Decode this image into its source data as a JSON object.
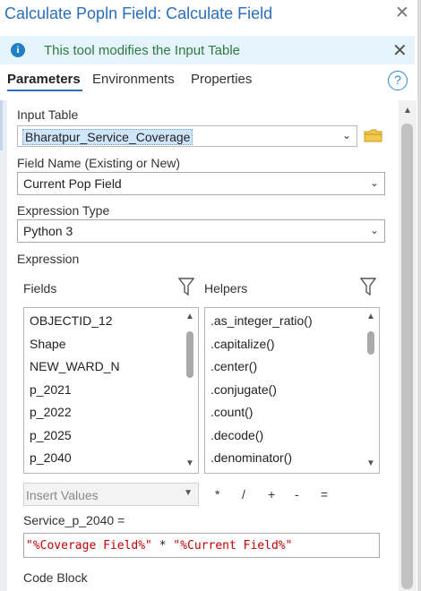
{
  "window": {
    "title": "Calculate Popln Field: Calculate Field",
    "close": "✕"
  },
  "banner": {
    "icon": "info-icon",
    "message": "This tool modifies the Input Table",
    "close": "✕"
  },
  "tabs": [
    {
      "label": "Parameters",
      "active": true
    },
    {
      "label": "Environments",
      "active": false
    },
    {
      "label": "Properties",
      "active": false
    }
  ],
  "help": {
    "label": "?"
  },
  "params": {
    "input_table": {
      "label": "Input Table",
      "value": "Bharatpur_Service_Coverage"
    },
    "field_name": {
      "label": "Field Name (Existing or New)",
      "value": "Current Pop Field"
    },
    "expression_type": {
      "label": "Expression Type",
      "value": "Python 3"
    },
    "expression": {
      "label": "Expression"
    }
  },
  "fields": {
    "label": "Fields",
    "items": [
      "OBJECTID_12",
      "Shape",
      "NEW_WARD_N",
      "p_2021",
      "p_2022",
      "p_2025",
      "p_2040"
    ]
  },
  "helpers": {
    "label": "Helpers",
    "items": [
      ".as_integer_ratio()",
      ".capitalize()",
      ".center()",
      ".conjugate()",
      ".count()",
      ".decode()",
      ".denominator()"
    ]
  },
  "insert_values": {
    "label": "Insert Values"
  },
  "operators": [
    "*",
    "/",
    "+",
    "-",
    "="
  ],
  "assignment": {
    "label": "Service_p_2040 ="
  },
  "expression_text": {
    "part1": "\"%Coverage Field%\"",
    "part2": " * ",
    "part3": "\"%Current Field%\""
  },
  "code_block": {
    "label": "Code Block"
  },
  "colors": {
    "accent": "#2a6ebd",
    "banner_bg": "#e6f4fb",
    "banner_text": "#2e7a3e",
    "expression_red": "#c00000",
    "folder_yellow": "#e8b73a"
  }
}
